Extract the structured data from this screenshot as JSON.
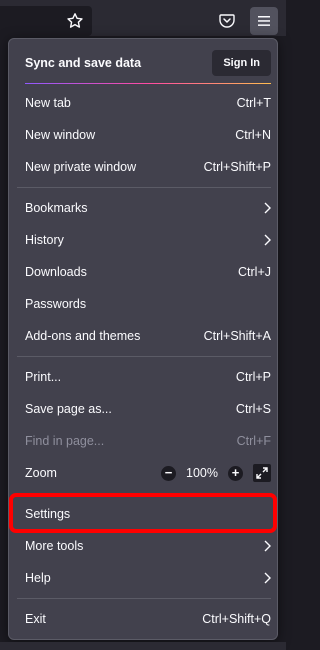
{
  "toolbar": {
    "star_icon": "star-icon",
    "pocket_icon": "pocket-icon",
    "menu_icon": "hamburger-menu-icon"
  },
  "menu": {
    "sync_title": "Sync and save data",
    "sign_in": "Sign In",
    "items": {
      "new_tab": {
        "label": "New tab",
        "shortcut": "Ctrl+T"
      },
      "new_window": {
        "label": "New window",
        "shortcut": "Ctrl+N"
      },
      "new_private_window": {
        "label": "New private window",
        "shortcut": "Ctrl+Shift+P"
      },
      "bookmarks": {
        "label": "Bookmarks"
      },
      "history": {
        "label": "History"
      },
      "downloads": {
        "label": "Downloads",
        "shortcut": "Ctrl+J"
      },
      "passwords": {
        "label": "Passwords"
      },
      "addons": {
        "label": "Add-ons and themes",
        "shortcut": "Ctrl+Shift+A"
      },
      "print": {
        "label": "Print...",
        "shortcut": "Ctrl+P"
      },
      "save_page": {
        "label": "Save page as...",
        "shortcut": "Ctrl+S"
      },
      "find": {
        "label": "Find in page...",
        "shortcut": "Ctrl+F"
      },
      "zoom": {
        "label": "Zoom",
        "minus": "−",
        "value": "100%",
        "plus": "+"
      },
      "settings": {
        "label": "Settings"
      },
      "more_tools": {
        "label": "More tools"
      },
      "help": {
        "label": "Help"
      },
      "exit": {
        "label": "Exit",
        "shortcut": "Ctrl+Shift+Q"
      }
    }
  },
  "colors": {
    "panel_bg": "#42414d",
    "highlight": "#ff0000"
  }
}
